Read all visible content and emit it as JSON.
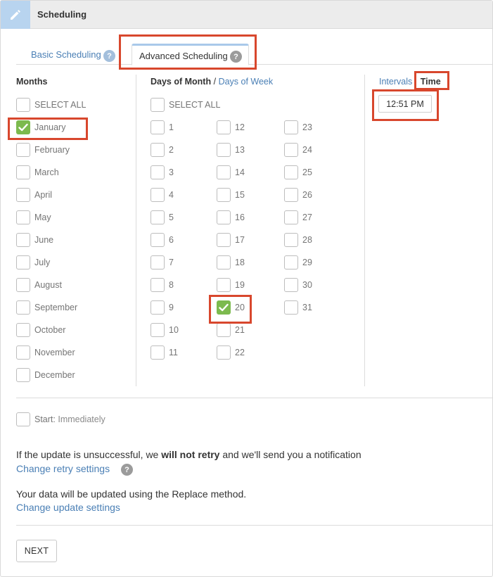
{
  "header": {
    "title": "Scheduling",
    "icon": "pencil-icon"
  },
  "tabs": {
    "basic_label": "Basic Scheduling",
    "advanced_label": "Advanced Scheduling",
    "active": "Advanced Scheduling"
  },
  "months": {
    "heading": "Months",
    "select_all": "SELECT ALL",
    "items": [
      {
        "label": "January",
        "checked": true
      },
      {
        "label": "February",
        "checked": false
      },
      {
        "label": "March",
        "checked": false
      },
      {
        "label": "April",
        "checked": false
      },
      {
        "label": "May",
        "checked": false
      },
      {
        "label": "June",
        "checked": false
      },
      {
        "label": "July",
        "checked": false
      },
      {
        "label": "August",
        "checked": false
      },
      {
        "label": "September",
        "checked": false
      },
      {
        "label": "October",
        "checked": false
      },
      {
        "label": "November",
        "checked": false
      },
      {
        "label": "December",
        "checked": false
      }
    ]
  },
  "days": {
    "heading": "Days of Month",
    "separator": "/",
    "alt_link": "Days of Week",
    "select_all": "SELECT ALL",
    "checked": [
      20
    ]
  },
  "time": {
    "intervals_link": "Intervals",
    "heading": "Time",
    "value": "12:51 PM"
  },
  "start": {
    "label": "Start:",
    "value": "Immediately",
    "checked": false
  },
  "retry": {
    "text_before": "If the update is unsuccessful, we ",
    "text_bold": "will not retry",
    "text_after": " and we'll send you a notification",
    "link": "Change retry settings"
  },
  "update": {
    "text": "Your data will be updated using the Replace method.",
    "link": "Change update settings"
  },
  "next_label": "NEXT",
  "colors": {
    "accent": "#4a7fb5",
    "check": "#7cba4e",
    "highlight": "#d8472d"
  }
}
